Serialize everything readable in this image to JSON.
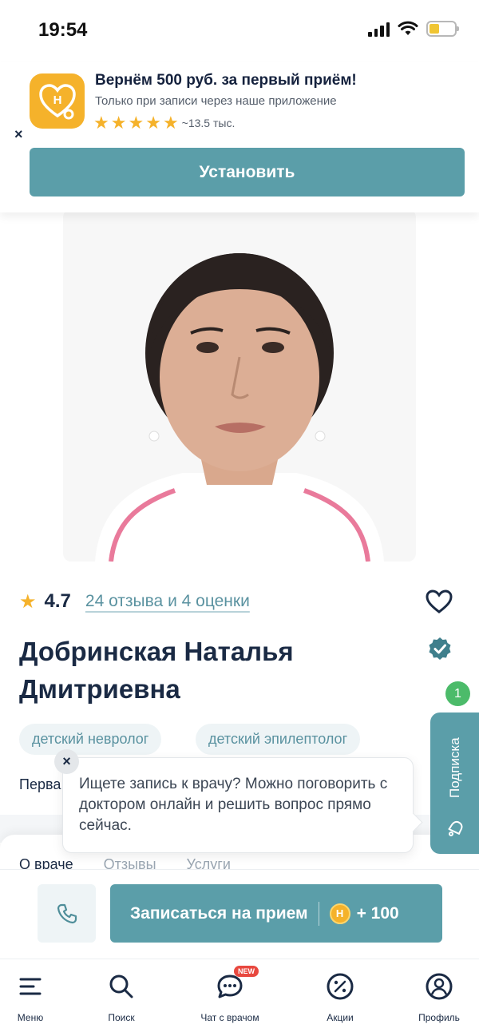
{
  "status_bar": {
    "time": "19:54"
  },
  "app_banner": {
    "title": "Вернём 500 руб. за первый приём!",
    "subtitle": "Только при записи через наше приложение",
    "rating_count": "~13.5 тыс.",
    "install_label": "Установить",
    "close_label": "×",
    "icon_letter": "H"
  },
  "doctor": {
    "rating": "4.7",
    "reviews_link": "24 отзыва и 4 оценки",
    "name": "Добринская Наталья Дмитриевна",
    "specialties": [
      "детский невролог",
      "детский эпилептолог"
    ],
    "truncated_text": "Перва"
  },
  "subscribe": {
    "label": "Подписка",
    "badge_count": "1"
  },
  "tooltip": {
    "text": "Ищете запись к врачу? Можно поговорить с доктором онлайн и решить вопрос прямо сейчас.",
    "close_label": "×"
  },
  "tabs": [
    "О враче",
    "Отзывы",
    "Услуги"
  ],
  "action_bar": {
    "book_label": "Записаться на прием",
    "coin_letter": "H",
    "bonus": "+ 100"
  },
  "bottom_nav": {
    "items": [
      {
        "label": "Меню",
        "icon": "menu-icon"
      },
      {
        "label": "Поиск",
        "icon": "search-icon"
      },
      {
        "label": "Чат с врачом",
        "icon": "chat-icon",
        "badge": "NEW"
      },
      {
        "label": "Акции",
        "icon": "percent-icon"
      },
      {
        "label": "Профиль",
        "icon": "profile-icon"
      }
    ]
  },
  "colors": {
    "accent": "#5b9ea9",
    "star": "#f5b22b",
    "text": "#1a2a44",
    "badge_green": "#4cbb6a"
  }
}
